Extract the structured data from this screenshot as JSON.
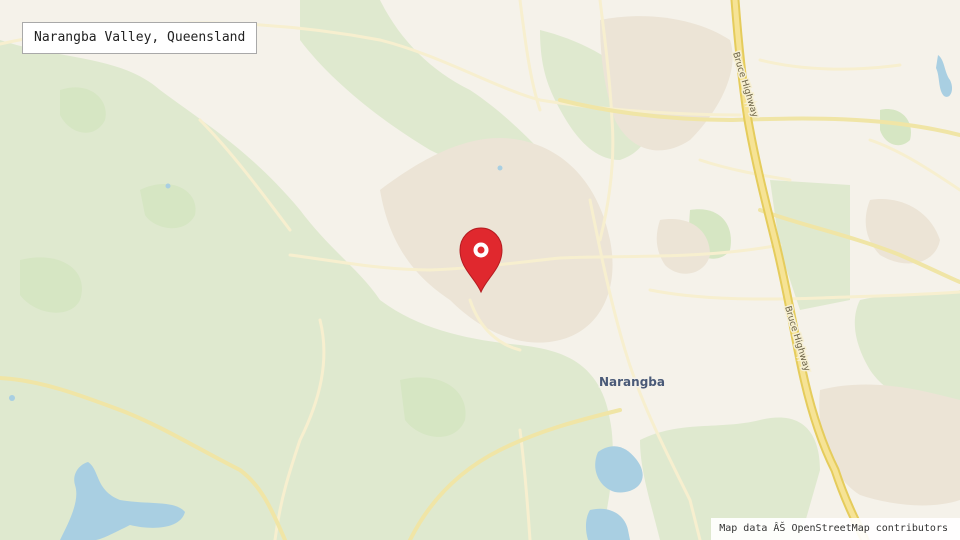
{
  "title": "Narangba Valley, Queensland",
  "attribution": "Map data ÂŠ OpenStreetMap contributors",
  "labels": {
    "suburb": "Narangba",
    "highway_north": "Bruce Highway",
    "highway_south": "Bruce Highway"
  },
  "marker": {
    "icon": "map-pin-icon",
    "color": "#e0282e"
  },
  "colors": {
    "land": "#f5f2ea",
    "forest": "#dde8cc",
    "park": "#d5e6c2",
    "water": "#a9cfe2",
    "road_major": "#f1e48f",
    "road_minor": "#f7efcf",
    "residential": "#ebe3d5"
  }
}
